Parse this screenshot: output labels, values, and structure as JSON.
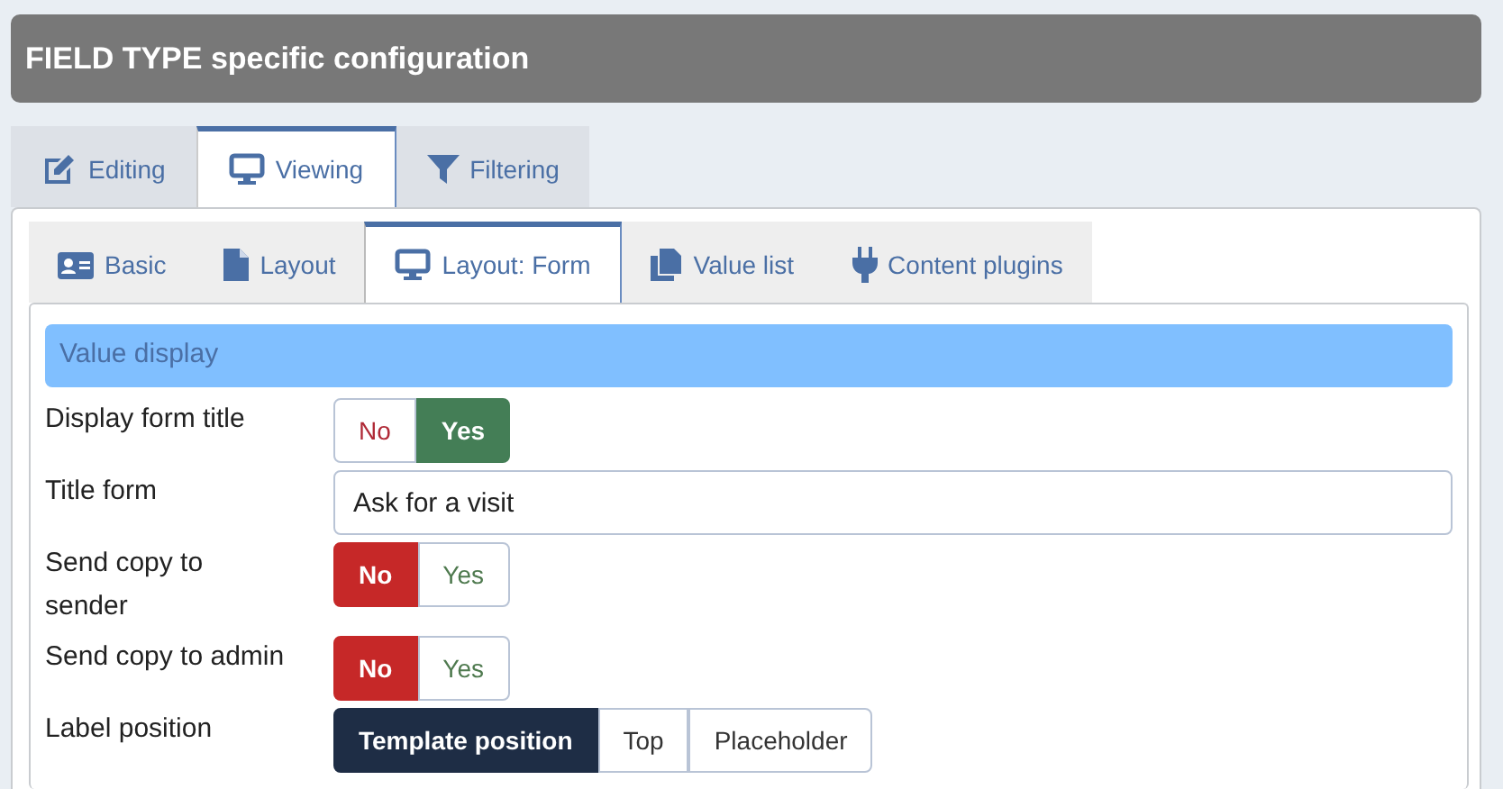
{
  "header": {
    "title": "FIELD TYPE specific configuration"
  },
  "outer_tabs": [
    {
      "label": "Editing",
      "kind": "edit",
      "selected": false
    },
    {
      "label": "Viewing",
      "kind": "monitor",
      "selected": true
    },
    {
      "label": "Filtering",
      "kind": "funnel",
      "selected": false
    }
  ],
  "inner_tabs": [
    {
      "label": "Basic",
      "kind": "card",
      "selected": false
    },
    {
      "label": "Layout",
      "kind": "file",
      "selected": false
    },
    {
      "label": "Layout: Form",
      "kind": "monitor",
      "selected": true
    },
    {
      "label": "Value list",
      "kind": "files",
      "selected": false
    },
    {
      "label": "Content plugins",
      "kind": "plug",
      "selected": false
    }
  ],
  "section": {
    "title": "Value display"
  },
  "fields": [
    {
      "label": "Display form title",
      "kind": "toggle",
      "options": [
        {
          "label": "No",
          "kind": "no",
          "selected": false
        },
        {
          "label": "Yes",
          "kind": "yes",
          "selected": true
        }
      ]
    },
    {
      "label": "Title form",
      "kind": "text",
      "value": "Ask for a visit"
    },
    {
      "label": "Send copy to sender",
      "kind": "toggle",
      "options": [
        {
          "label": "No",
          "kind": "no",
          "selected": true
        },
        {
          "label": "Yes",
          "kind": "yes",
          "selected": false
        }
      ]
    },
    {
      "label": "Send copy to admin",
      "kind": "toggle",
      "options": [
        {
          "label": "No",
          "kind": "no",
          "selected": true
        },
        {
          "label": "Yes",
          "kind": "yes",
          "selected": false
        }
      ]
    },
    {
      "label": "Label position",
      "kind": "toggle",
      "options": [
        {
          "label": "Template position",
          "kind": "choice",
          "selected": true
        },
        {
          "label": "Top",
          "kind": "choice",
          "selected": false
        },
        {
          "label": "Placeholder",
          "kind": "choice",
          "selected": false
        }
      ]
    }
  ]
}
